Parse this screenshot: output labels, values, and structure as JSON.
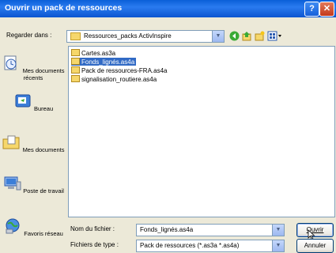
{
  "dialog": {
    "title": "Ouvrir un pack de ressources",
    "help_glyph": "?",
    "close_glyph": "✕"
  },
  "lookin": {
    "label": "Regarder dans :",
    "value": "Ressources_packs ActivInspire"
  },
  "toolbar": {
    "icons": [
      "back-icon",
      "up-folder-icon",
      "new-folder-icon",
      "views-menu-icon"
    ]
  },
  "places": [
    {
      "label": "Mes documents récents",
      "icon": "recent-documents-icon"
    },
    {
      "label": "Bureau",
      "icon": "desktop-icon"
    },
    {
      "label": "Mes documents",
      "icon": "my-documents-icon"
    },
    {
      "label": "Poste de travail",
      "icon": "my-computer-icon"
    },
    {
      "label": "Favoris réseau",
      "icon": "network-places-icon"
    }
  ],
  "files": [
    {
      "name": "Cartes.as3a",
      "selected": false
    },
    {
      "name": "Fonds_lignés.as4a",
      "selected": true
    },
    {
      "name": "Pack de ressources-FRA.as4a",
      "selected": false
    },
    {
      "name": "signalisation_routiere.as4a",
      "selected": false
    }
  ],
  "filename": {
    "label": "Nom du fichier :",
    "value": "Fonds_lignés.as4a"
  },
  "filetype": {
    "label": "Fichiers de type :",
    "value": "Pack de ressources (*.as3a *.as4a)"
  },
  "buttons": {
    "open": "Ouvrir",
    "cancel": "Annuler"
  },
  "colors": {
    "titlebar": "#0A5FD8",
    "selection": "#316AC5",
    "dialog_bg": "#ECE9D8"
  }
}
